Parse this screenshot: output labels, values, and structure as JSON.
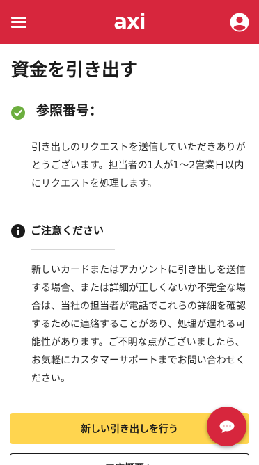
{
  "header": {
    "logo_text": "axi",
    "menu_icon": "hamburger-menu-icon",
    "account_icon": "user-account-icon",
    "brand_color": "#d7263d"
  },
  "page": {
    "title": "資金を引き出す"
  },
  "reference": {
    "icon": "check-circle-icon",
    "label": "参照番号：",
    "value": ""
  },
  "confirmation": {
    "text": "引き出しのリクエストを送信していただきありがとうございます。担当者の1人が1〜2営業日以内にリクエストを処理します。"
  },
  "notice": {
    "icon": "info-icon",
    "title": "ご注意ください",
    "text": "新しいカードまたはアカウントに引き出しを送信する場合、または詳細が正しくないか不完全な場合は、当社の担当者が電話でこれらの詳細を確認するために連絡することがあり、処理が遅れる可能性があります。ご不明な点がございましたら、お気軽にカスタマーサポートまでお問い合わせください。"
  },
  "actions": {
    "primary_label": "新しい引き出しを行う",
    "primary_color": "#ffd54f",
    "secondary_label": "口座概要へ"
  },
  "chat": {
    "icon": "chat-bubble-icon"
  }
}
